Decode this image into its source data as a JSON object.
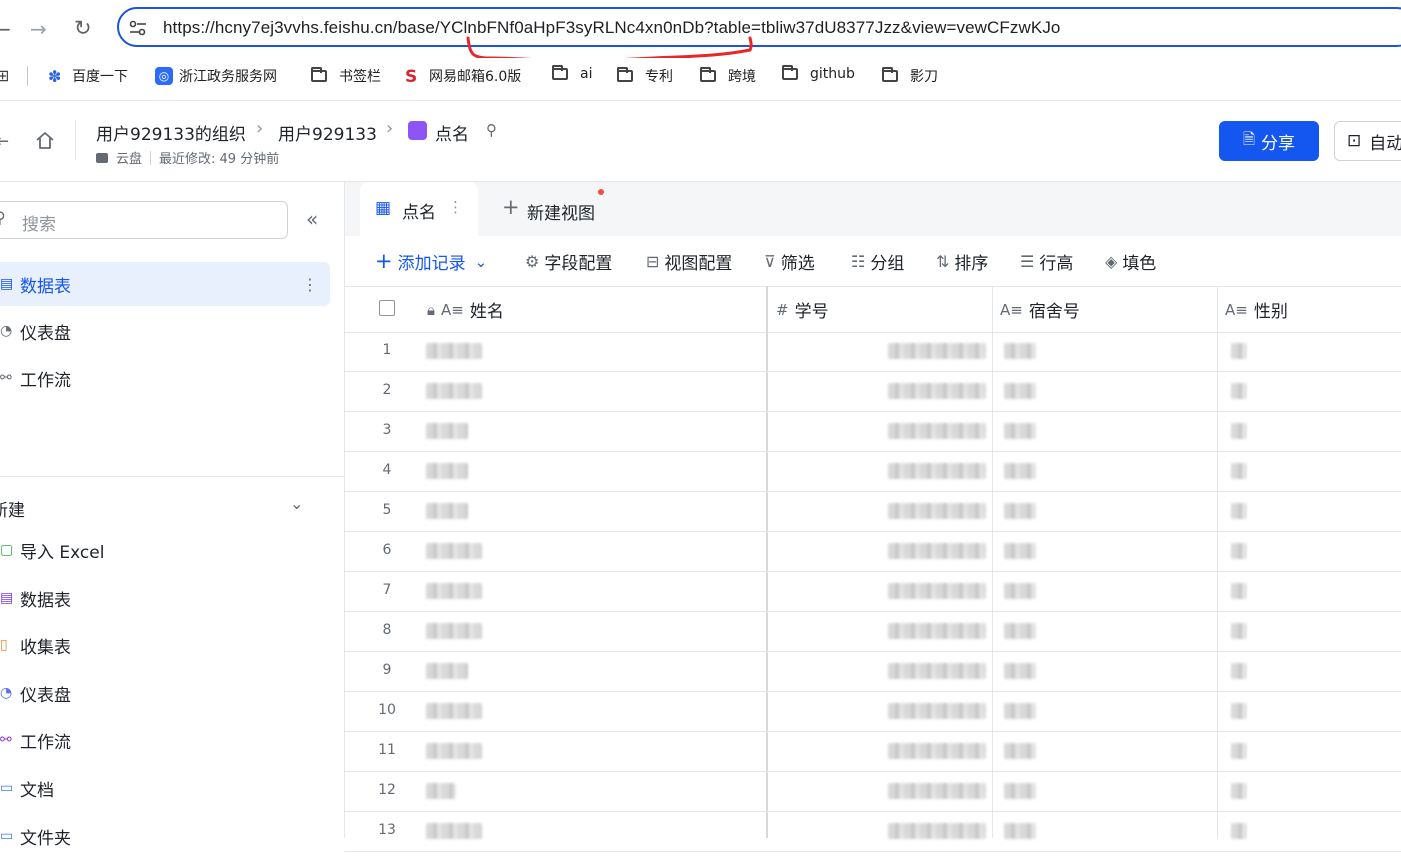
{
  "browser": {
    "url": "https://hcny7ej3vvhs.feishu.cn/base/YClnbFNf0aHpF3syRLNc4xn0nDb?table=tbliw37dU8377Jzz&view=vewCFzwKJo",
    "back_icon": "back-arrow-icon",
    "forward_icon": "forward-arrow-icon",
    "reload_icon": "reload-icon",
    "annotation_color": "#e8272a"
  },
  "bookmarks": [
    {
      "label": "百度一下",
      "icon": "baidu-paw-icon"
    },
    {
      "label": "浙江政务服务网",
      "icon": "zj-gov-icon"
    },
    {
      "label": "书签栏",
      "icon": "folder-icon"
    },
    {
      "label": "网易邮箱6.0版",
      "icon": "netease-icon"
    },
    {
      "label": "ai",
      "icon": "folder-icon"
    },
    {
      "label": "专利",
      "icon": "folder-icon"
    },
    {
      "label": "跨境",
      "icon": "folder-icon"
    },
    {
      "label": "github",
      "icon": "folder-icon"
    },
    {
      "label": "影刀",
      "icon": "folder-icon"
    }
  ],
  "header": {
    "breadcrumb": [
      "用户929133的组织",
      "用户929133",
      "点名"
    ],
    "location": "云盘",
    "modified": "最近修改: 49 分钟前",
    "share_label": "分享",
    "auto_label": "自动",
    "accent": "#1456f0"
  },
  "sidebar": {
    "search_placeholder": "搜索",
    "items": [
      {
        "label": "数据表",
        "active": true
      },
      {
        "label": "仪表盘",
        "active": false
      },
      {
        "label": "工作流",
        "active": false
      }
    ],
    "new_section": "新建",
    "new_items": [
      {
        "label": "导入 Excel",
        "icon_color": "#34a853"
      },
      {
        "label": "数据表",
        "icon_color": "#7f3bf5"
      },
      {
        "label": "收集表",
        "icon_color": "#f5883b"
      },
      {
        "label": "仪表盘",
        "icon_color": "#5b6ef5"
      },
      {
        "label": "工作流",
        "icon_color": "#8f3bd0"
      },
      {
        "label": "文档",
        "icon_color": "#3b7bf5"
      },
      {
        "label": "文件夹",
        "icon_color": "#3b7bf5"
      }
    ]
  },
  "view_tabs": {
    "active": "点名",
    "new_view": "新建视图"
  },
  "toolbar": {
    "add_record": "添加记录",
    "fields": "字段配置",
    "view_config": "视图配置",
    "filter": "筛选",
    "group": "分组",
    "sort": "排序",
    "row_height": "行高",
    "fill": "填色"
  },
  "table": {
    "columns": [
      {
        "label": "姓名",
        "type_icon": "text-field-icon"
      },
      {
        "label": "学号",
        "type_icon": "number-field-icon"
      },
      {
        "label": "宿舍号",
        "type_icon": "text-field-icon"
      },
      {
        "label": "性别",
        "type_icon": "text-field-icon"
      }
    ],
    "row_numbers": [
      "1",
      "2",
      "3",
      "4",
      "5",
      "6",
      "7",
      "8",
      "9",
      "10",
      "11",
      "12",
      "13"
    ]
  }
}
